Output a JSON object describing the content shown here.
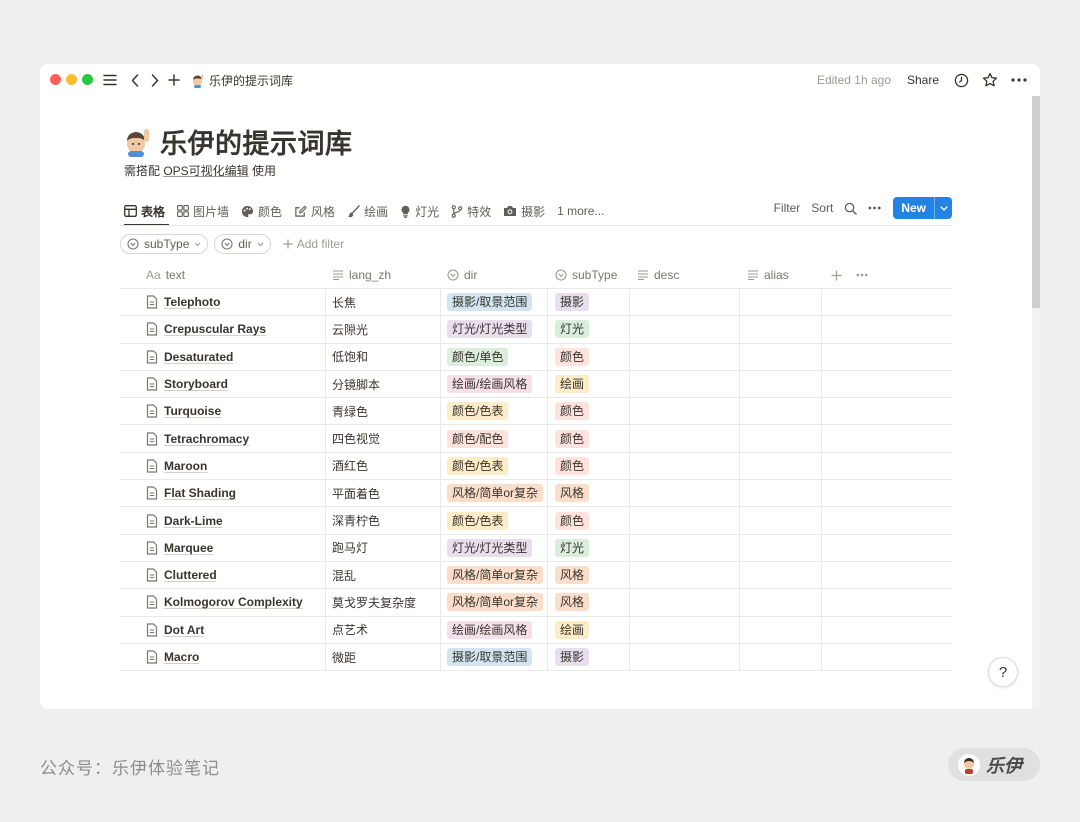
{
  "topbar": {
    "breadcrumb_title": "乐伊的提示词库",
    "edited": "Edited 1h ago",
    "share": "Share"
  },
  "page": {
    "title": "乐伊的提示词库",
    "subtitle_prefix": "需搭配 ",
    "subtitle_link": "OPS可视化编辑",
    "subtitle_suffix": " 使用"
  },
  "views": [
    {
      "label": "表格",
      "icon": "table-icon"
    },
    {
      "label": "图片墙",
      "icon": "gallery-icon"
    },
    {
      "label": "颜色",
      "icon": "palette-icon"
    },
    {
      "label": "风格",
      "icon": "edit-icon"
    },
    {
      "label": "绘画",
      "icon": "brush-icon"
    },
    {
      "label": "灯光",
      "icon": "bulb-icon"
    },
    {
      "label": "特效",
      "icon": "branch-icon"
    },
    {
      "label": "摄影",
      "icon": "camera-icon"
    },
    {
      "label": "1 more..."
    }
  ],
  "actions": {
    "filter": "Filter",
    "sort": "Sort",
    "new": "New"
  },
  "filters": {
    "chip1": "subType",
    "chip2": "dir",
    "add": "Add filter"
  },
  "columns": {
    "text": "text",
    "text_prefix": "Aa",
    "lang_zh": "lang_zh",
    "dir": "dir",
    "subType": "subType",
    "desc": "desc",
    "alias": "alias"
  },
  "tag_colors": {
    "摄影/取景范围": "#d3e5ef",
    "灯光/灯光类型": "#e8deee",
    "颜色/单色": "#dbeddb",
    "绘画/绘画风格": "#f5e0e9",
    "颜色/色表": "#fdecc8",
    "颜色/配色": "#ffe2dd",
    "风格/简单or复杂": "#fadec9",
    "摄影": "#e8deee",
    "灯光": "#dbeddb",
    "颜色": "#ffe2dd",
    "绘画": "#fdecc8",
    "风格": "#fadec9"
  },
  "rows": [
    {
      "text": "Telephoto",
      "lang_zh": "长焦",
      "dir": "摄影/取景范围",
      "subType": "摄影"
    },
    {
      "text": "Crepuscular Rays",
      "lang_zh": "云隙光",
      "dir": "灯光/灯光类型",
      "subType": "灯光"
    },
    {
      "text": "Desaturated",
      "lang_zh": "低饱和",
      "dir": "颜色/单色",
      "subType": "颜色"
    },
    {
      "text": "Storyboard",
      "lang_zh": "分镜脚本",
      "dir": "绘画/绘画风格",
      "subType": "绘画"
    },
    {
      "text": "Turquoise",
      "lang_zh": "青绿色",
      "dir": "颜色/色表",
      "subType": "颜色"
    },
    {
      "text": "Tetrachromacy",
      "lang_zh": "四色视觉",
      "dir": "颜色/配色",
      "subType": "颜色"
    },
    {
      "text": "Maroon",
      "lang_zh": "酒红色",
      "dir": "颜色/色表",
      "subType": "颜色"
    },
    {
      "text": "Flat Shading",
      "lang_zh": "平面着色",
      "dir": "风格/简单or复杂",
      "subType": "风格"
    },
    {
      "text": "Dark-Lime",
      "lang_zh": "深青柠色",
      "dir": "颜色/色表",
      "subType": "颜色"
    },
    {
      "text": "Marquee",
      "lang_zh": "跑马灯",
      "dir": "灯光/灯光类型",
      "subType": "灯光"
    },
    {
      "text": "Cluttered",
      "lang_zh": "混乱",
      "dir": "风格/简单or复杂",
      "subType": "风格"
    },
    {
      "text": "Kolmogorov Complexity",
      "lang_zh": "莫戈罗夫复杂度",
      "dir": "风格/简单or复杂",
      "subType": "风格"
    },
    {
      "text": "Dot Art",
      "lang_zh": "点艺术",
      "dir": "绘画/绘画风格",
      "subType": "绘画"
    },
    {
      "text": "Macro",
      "lang_zh": "微距",
      "dir": "摄影/取景范围",
      "subType": "摄影"
    }
  ],
  "help": "?",
  "footer": {
    "left": "公众号：乐伊体验笔记",
    "badge": "乐伊"
  }
}
